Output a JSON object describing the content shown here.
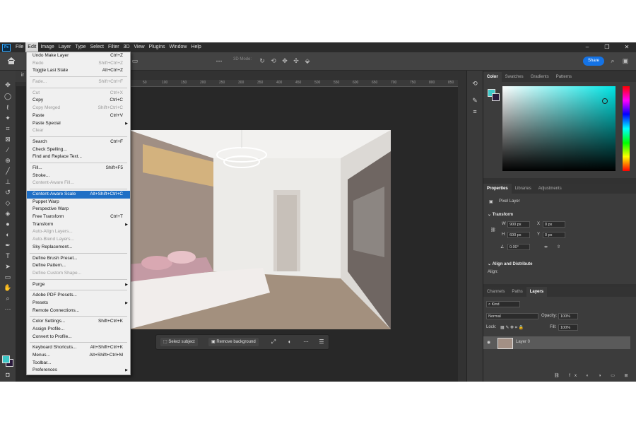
{
  "menubar": {
    "logo": "Ps",
    "items": [
      "File",
      "Edit",
      "Image",
      "Layer",
      "Type",
      "Select",
      "Filter",
      "3D",
      "View",
      "Plugins",
      "Window",
      "Help"
    ],
    "active": "Edit"
  },
  "options": {
    "mode3d": "3D Mode:",
    "share": "Share"
  },
  "document_tab": {
    "label": "ir"
  },
  "ruler_ticks": [
    "50",
    "100",
    "150",
    "200",
    "250",
    "300",
    "350",
    "400",
    "450",
    "500",
    "550",
    "600",
    "650",
    "700",
    "750",
    "800",
    "850"
  ],
  "edit_menu": [
    {
      "label": "Undo Make Layer",
      "shortcut": "Ctrl+Z",
      "disabled": false
    },
    {
      "label": "Redo",
      "shortcut": "Shift+Ctrl+Z",
      "disabled": true
    },
    {
      "label": "Toggle Last State",
      "shortcut": "Alt+Ctrl+Z",
      "disabled": false
    },
    {
      "sep": true
    },
    {
      "label": "Fade...",
      "shortcut": "Shift+Ctrl+F",
      "disabled": true
    },
    {
      "sep": true
    },
    {
      "label": "Cut",
      "shortcut": "Ctrl+X",
      "disabled": true
    },
    {
      "label": "Copy",
      "shortcut": "Ctrl+C",
      "disabled": false
    },
    {
      "label": "Copy Merged",
      "shortcut": "Shift+Ctrl+C",
      "disabled": true
    },
    {
      "label": "Paste",
      "shortcut": "Ctrl+V",
      "disabled": false
    },
    {
      "label": "Paste Special",
      "shortcut": "",
      "disabled": false,
      "submenu": true
    },
    {
      "label": "Clear",
      "shortcut": "",
      "disabled": true
    },
    {
      "sep": true
    },
    {
      "label": "Search",
      "shortcut": "Ctrl+F",
      "disabled": false
    },
    {
      "label": "Check Spelling...",
      "shortcut": "",
      "disabled": false
    },
    {
      "label": "Find and Replace Text...",
      "shortcut": "",
      "disabled": false
    },
    {
      "sep": true
    },
    {
      "label": "Fill...",
      "shortcut": "Shift+F5",
      "disabled": false
    },
    {
      "label": "Stroke...",
      "shortcut": "",
      "disabled": false
    },
    {
      "label": "Content-Aware Fill...",
      "shortcut": "",
      "disabled": true
    },
    {
      "sep": true
    },
    {
      "label": "Content-Aware Scale",
      "shortcut": "Alt+Shift+Ctrl+C",
      "disabled": false,
      "highlight": true
    },
    {
      "label": "Puppet Warp",
      "shortcut": "",
      "disabled": false
    },
    {
      "label": "Perspective Warp",
      "shortcut": "",
      "disabled": false
    },
    {
      "label": "Free Transform",
      "shortcut": "Ctrl+T",
      "disabled": false
    },
    {
      "label": "Transform",
      "shortcut": "",
      "disabled": false,
      "submenu": true
    },
    {
      "label": "Auto-Align Layers...",
      "shortcut": "",
      "disabled": true
    },
    {
      "label": "Auto-Blend Layers...",
      "shortcut": "",
      "disabled": true
    },
    {
      "label": "Sky Replacement...",
      "shortcut": "",
      "disabled": false
    },
    {
      "sep": true
    },
    {
      "label": "Define Brush Preset...",
      "shortcut": "",
      "disabled": false
    },
    {
      "label": "Define Pattern...",
      "shortcut": "",
      "disabled": false
    },
    {
      "label": "Define Custom Shape...",
      "shortcut": "",
      "disabled": true
    },
    {
      "sep": true
    },
    {
      "label": "Purge",
      "shortcut": "",
      "disabled": false,
      "submenu": true
    },
    {
      "sep": true
    },
    {
      "label": "Adobe PDF Presets...",
      "shortcut": "",
      "disabled": false
    },
    {
      "label": "Presets",
      "shortcut": "",
      "disabled": false,
      "submenu": true
    },
    {
      "label": "Remote Connections...",
      "shortcut": "",
      "disabled": false
    },
    {
      "sep": true
    },
    {
      "label": "Color Settings...",
      "shortcut": "Shift+Ctrl+K",
      "disabled": false
    },
    {
      "label": "Assign Profile...",
      "shortcut": "",
      "disabled": false
    },
    {
      "label": "Convert to Profile...",
      "shortcut": "",
      "disabled": false
    },
    {
      "sep": true
    },
    {
      "label": "Keyboard Shortcuts...",
      "shortcut": "Alt+Shift+Ctrl+K",
      "disabled": false
    },
    {
      "label": "Menus...",
      "shortcut": "Alt+Shift+Ctrl+M",
      "disabled": false
    },
    {
      "label": "Toolbar...",
      "shortcut": "",
      "disabled": false
    },
    {
      "label": "Preferences",
      "shortcut": "",
      "disabled": false,
      "submenu": true
    }
  ],
  "context_bar": {
    "select_subject": "Select subject",
    "remove_background": "Remove background"
  },
  "color_panel": {
    "tabs": [
      "Color",
      "Swatches",
      "Gradients",
      "Patterns"
    ],
    "foreground": "#3dc7c7",
    "background": "#2a1a3c"
  },
  "properties_panel": {
    "tabs": [
      "Properties",
      "Libraries",
      "Adjustments"
    ],
    "type_label": "Pixel Layer",
    "transform_title": "Transform",
    "w_label": "W",
    "w": "900 px",
    "x_label": "X",
    "x": "0 px",
    "h_label": "H",
    "h": "600 px",
    "y_label": "Y",
    "y": "0 px",
    "angle": "0.00°",
    "align_title": "Align and Distribute",
    "align_label": "Align:"
  },
  "layers_panel": {
    "tabs": [
      "Channels",
      "Paths",
      "Layers"
    ],
    "kind": "Kind",
    "blend": "Normal",
    "opacity_label": "Opacity:",
    "opacity": "100%",
    "lock_label": "Lock:",
    "fill_label": "Fill:",
    "fill": "100%",
    "layer_name": "Layer 0"
  }
}
